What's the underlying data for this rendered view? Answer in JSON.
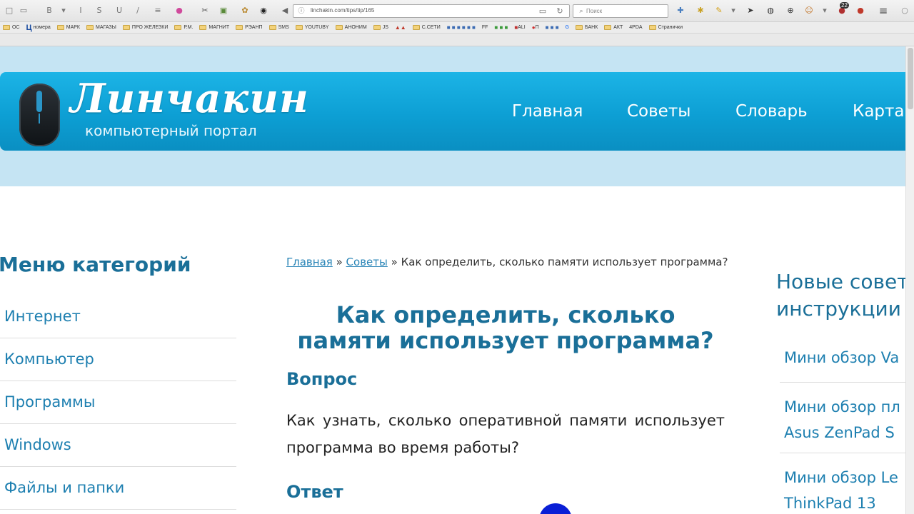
{
  "browser": {
    "url": "linchakin.com/tips/tip/165",
    "search_placeholder": "Поиск",
    "badge_count": "22",
    "bookmarks": [
      "ОС",
      "Ц",
      "номера",
      "МАРК",
      "МАГАЗЫ",
      "ПРО ЖЕЛЕЗКИ",
      "Р.М.",
      "МАГНИТ",
      "РЭАНП",
      "SMS",
      "YOUTUBY",
      "АНОНИМ",
      "JS",
      "С.СЕТИ",
      "FF",
      "ALI",
      "П",
      "G",
      "БАНК",
      "АКТ",
      "4PDA",
      "Странички"
    ]
  },
  "site": {
    "logo_title": "Линчакин",
    "logo_subtitle": "компьютерный портал",
    "nav": [
      "Главная",
      "Советы",
      "Словарь",
      "Карта"
    ]
  },
  "sidebar": {
    "title": "Меню категорий",
    "items": [
      "Интернет",
      "Компьютер",
      "Программы",
      "Windows",
      "Файлы и папки"
    ]
  },
  "article": {
    "breadcrumb": {
      "home": "Главная",
      "sep1": "»",
      "tips": "Советы",
      "sep2": "»",
      "current": "Как определить, сколько памяти использует программа?"
    },
    "title": "Как определить, сколько памяти использует программа?",
    "question_heading": "Вопрос",
    "question_text": "Как узнать, сколько оперативной памяти использует программа во время работы?",
    "answer_heading": "Ответ"
  },
  "right_sidebar": {
    "title_line1": "Новые совет",
    "title_line2": "инструкции",
    "items": [
      {
        "line1": "Мини обзор Va",
        "line2": ""
      },
      {
        "line1": "Мини обзор пл",
        "line2": "Asus ZenPad S"
      },
      {
        "line1": "Мини обзор Le",
        "line2": "ThinkPad 13"
      }
    ]
  },
  "colors": {
    "header": "#0d9fd4",
    "header_band": "#c5e4f3",
    "link": "#1d7fb0",
    "heading": "#1a6f98"
  }
}
